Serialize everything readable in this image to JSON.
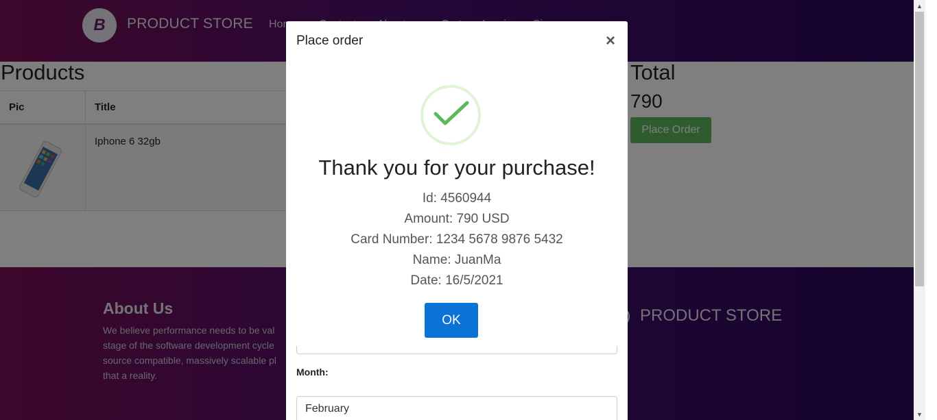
{
  "navbar": {
    "brand_logo_letter": "B",
    "brand_name": "PRODUCT STORE",
    "links": [
      "Home",
      "Contact",
      "About us",
      "Cart",
      "Log in",
      "Sign up"
    ]
  },
  "products": {
    "title": "Products",
    "columns": [
      "Pic",
      "Title"
    ],
    "rows": [
      {
        "title": "Iphone 6 32gb"
      }
    ]
  },
  "total": {
    "title": "Total",
    "value": "790",
    "place_order_label": "Place Order"
  },
  "footer": {
    "about_title": "About Us",
    "about_lines": [
      "We believe performance needs to be val",
      "stage of the software development cycle",
      "source compatible, massively scalable pl",
      "that a reality."
    ],
    "brand_name": "PRODUCT STORE"
  },
  "modal": {
    "title": "Place order",
    "close_glyph": "×",
    "month_label": "Month:",
    "month_value": "February"
  },
  "confirmation": {
    "heading": "Thank you for your purchase!",
    "id_line": "Id: 4560944",
    "amount_line": "Amount: 790 USD",
    "card_line": "Card Number: 1234 5678 9876 5432",
    "name_line": "Name: JuanMa",
    "date_line": "Date: 16/5/2021",
    "ok_label": "OK"
  },
  "colors": {
    "brand_gradient_start": "#7a1056",
    "brand_gradient_end": "#2a0a5a",
    "success_green": "#5cb85c",
    "check_green": "#5cb85c",
    "ok_blue": "#0b73d6"
  },
  "icons": {
    "success": "checkmark-icon",
    "close": "close-icon",
    "brand": "brand-logo-icon"
  }
}
